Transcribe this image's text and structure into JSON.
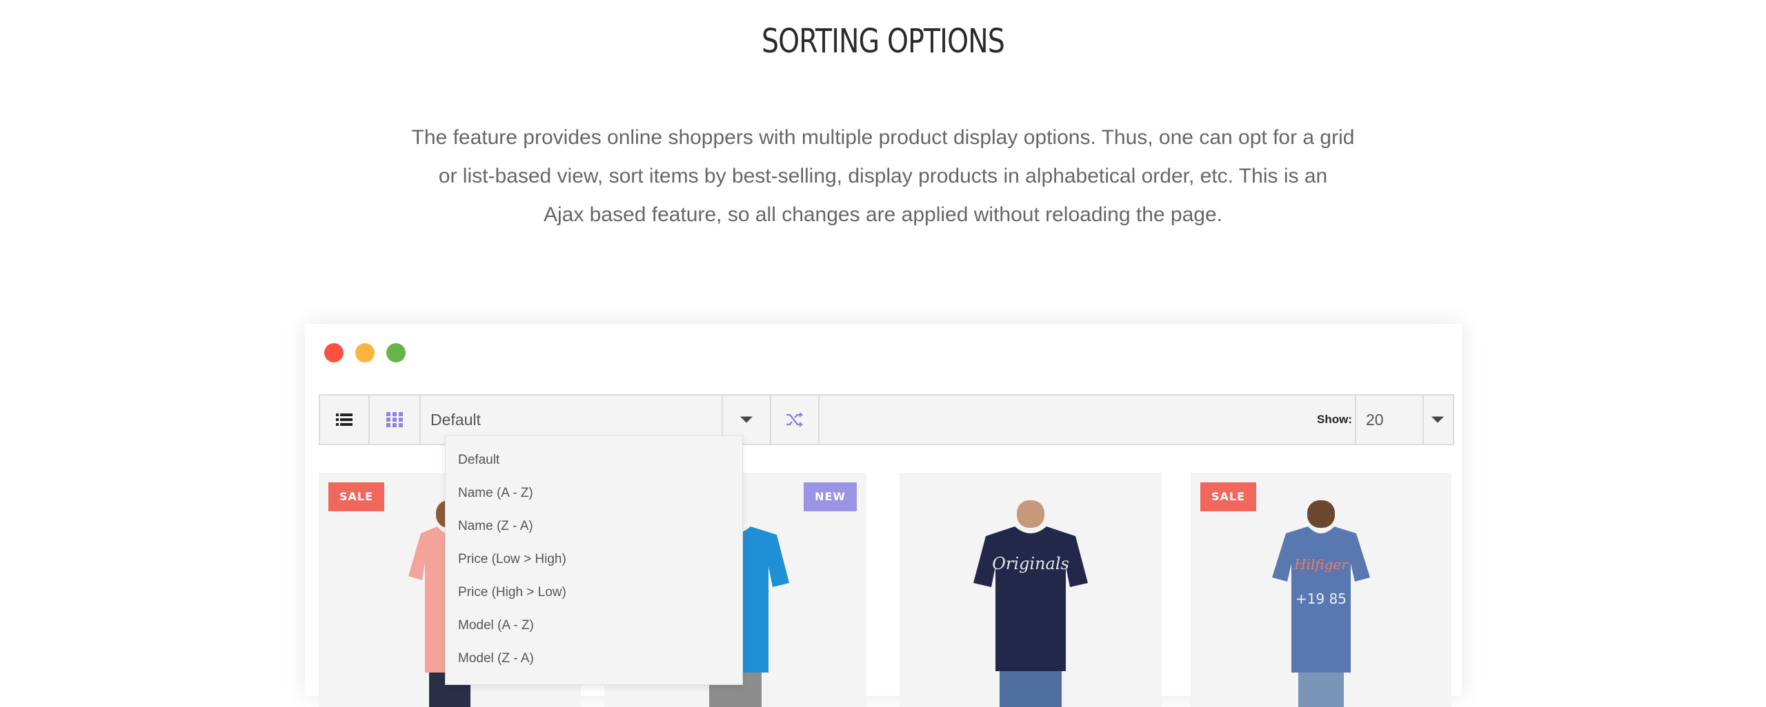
{
  "section": {
    "title": "SORTING OPTIONS",
    "description_lines": [
      "The feature provides online shoppers with multiple product display options. Thus, one can opt for a grid",
      "or list-based view, sort items by best-selling, display products in alphabetical order, etc. This is an",
      "Ajax based feature, so all changes are applied without reloading the page."
    ]
  },
  "window_controls": [
    "close",
    "minimize",
    "maximize"
  ],
  "toolbar": {
    "list_view_icon": "list-icon",
    "grid_view_icon": "grid-icon",
    "sort_selected": "Default",
    "random_icon": "shuffle-icon",
    "show_label": "Show:",
    "show_value": "20"
  },
  "sort_options": [
    "Default",
    "Name (A - Z)",
    "Name (Z - A)",
    "Price (Low > High)",
    "Price (High > Low)",
    "Model (A - Z)",
    "Model (Z - A)"
  ],
  "products": [
    {
      "badge": "SALE",
      "shirt_color": "#f3a39a"
    },
    {
      "badge": "NEW",
      "shirt_color": "#1f8fd6"
    },
    {
      "badge": "",
      "shirt_color": "#23284a"
    },
    {
      "badge": "SALE",
      "shirt_color": "#5a78b0"
    }
  ],
  "colors": {
    "sale": "#f0675b",
    "new": "#9b93e3",
    "accent_icon": "#8e86e0"
  }
}
